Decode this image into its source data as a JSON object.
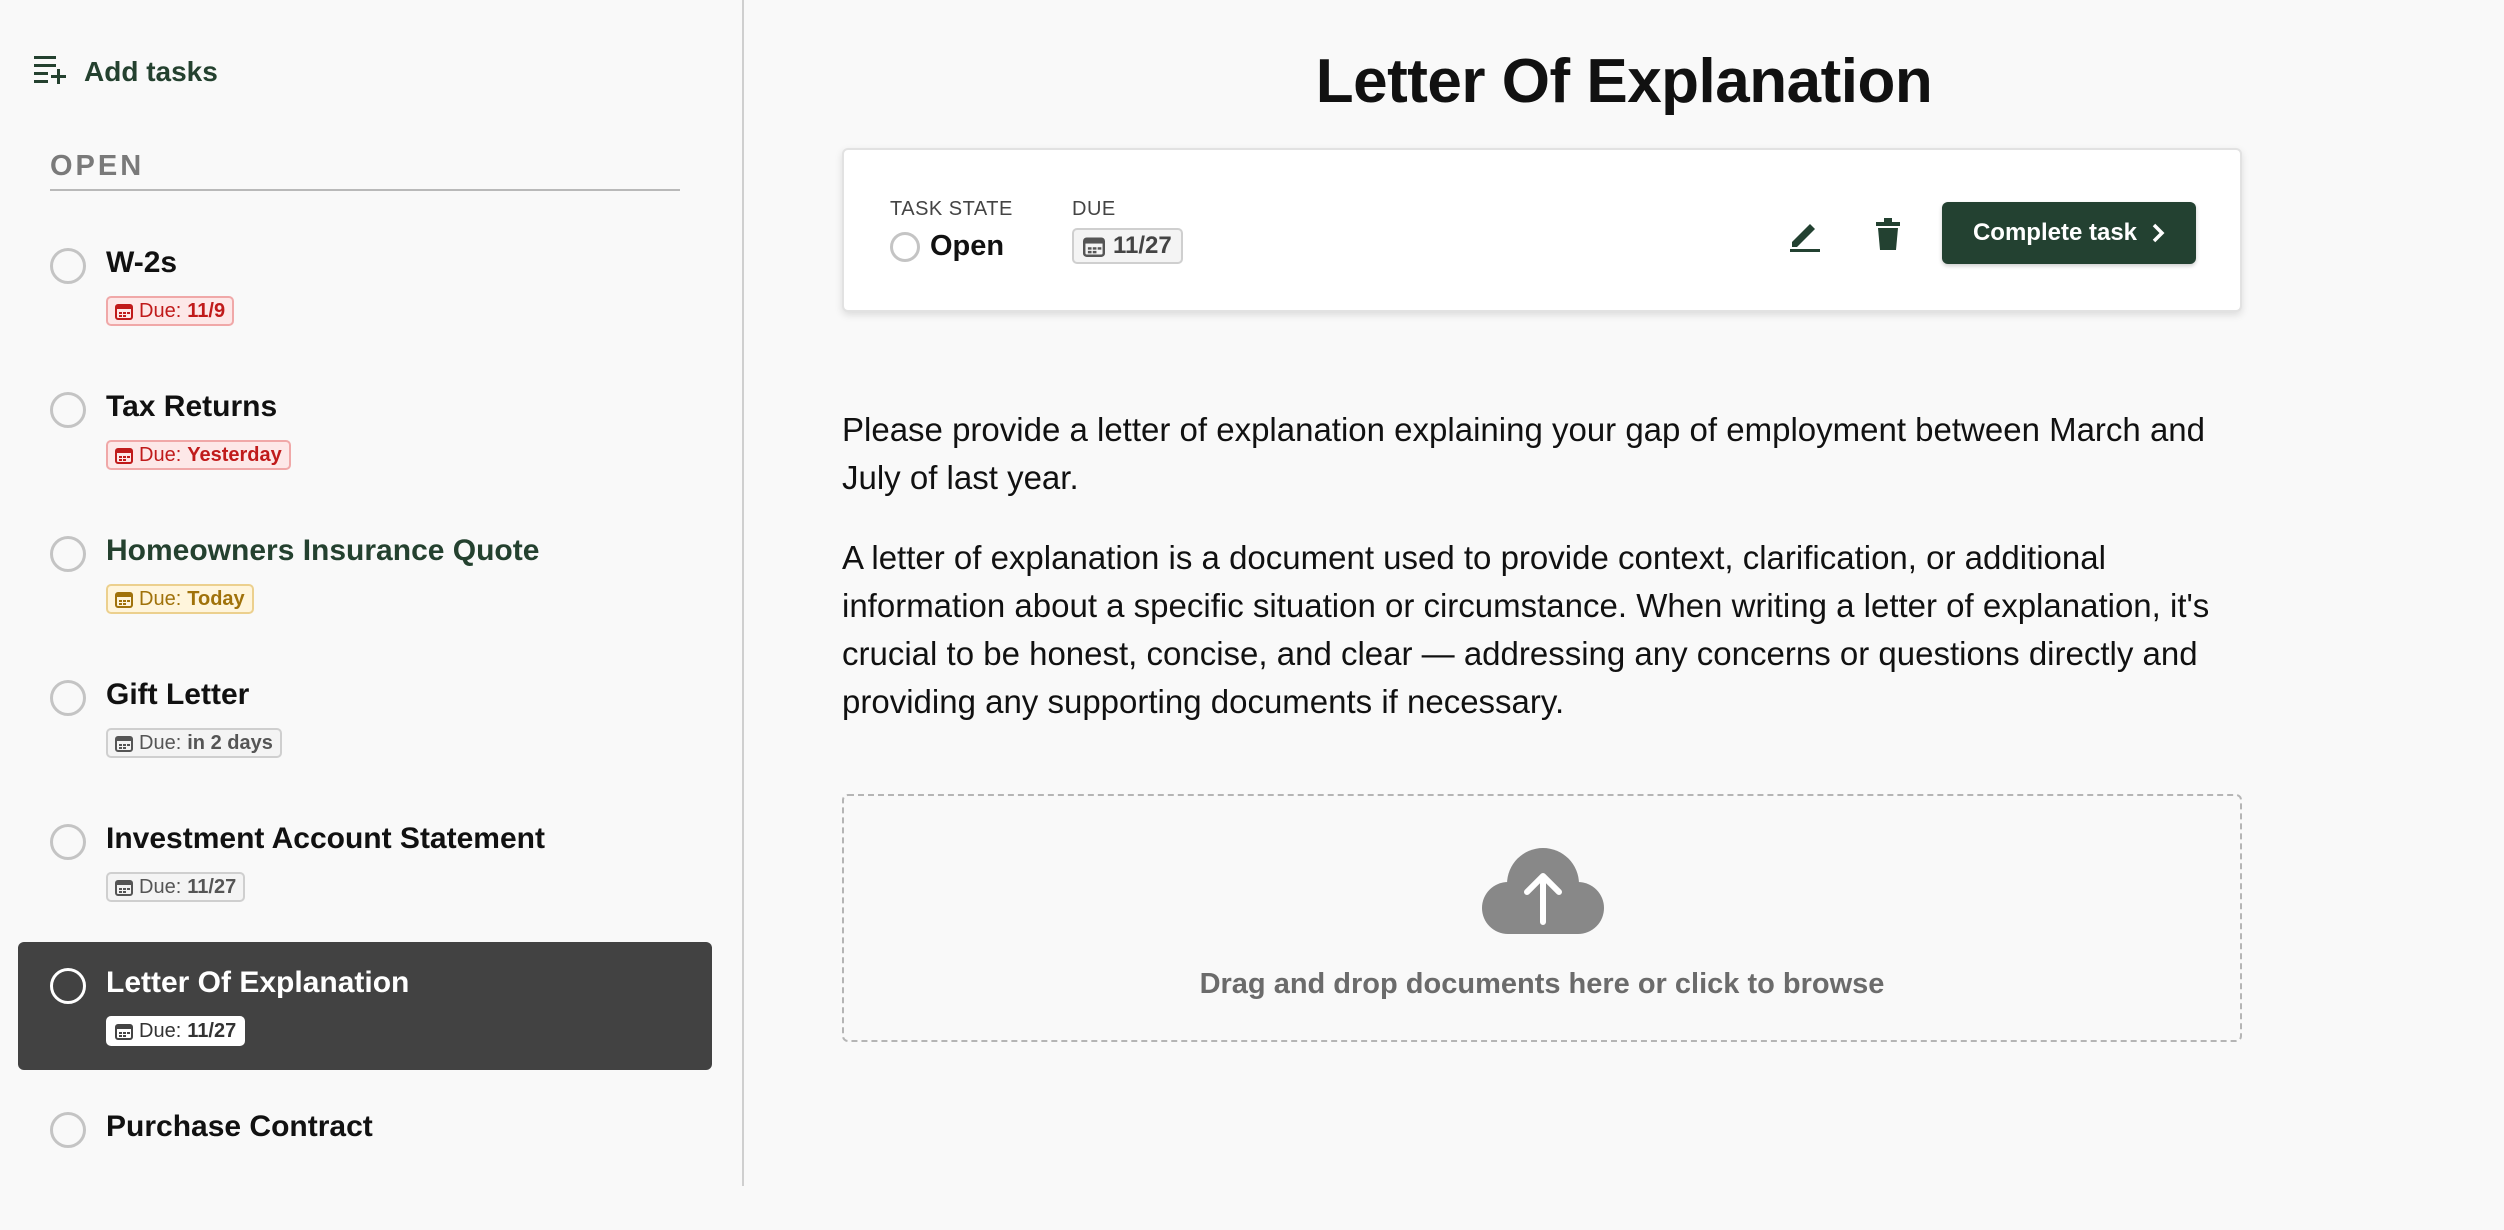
{
  "sidebar": {
    "add_tasks_label": "Add tasks",
    "section_header": "OPEN",
    "tasks": [
      {
        "title": "W-2s",
        "due_prefix": "Due:",
        "due_value": "11/9",
        "status": "overdue"
      },
      {
        "title": "Tax Returns",
        "due_prefix": "Due:",
        "due_value": "Yesterday",
        "status": "overdue"
      },
      {
        "title": "Homeowners Insurance Quote",
        "due_prefix": "Due:",
        "due_value": "Today",
        "status": "today"
      },
      {
        "title": "Gift Letter",
        "due_prefix": "Due:",
        "due_value": "in 2 days",
        "status": "upcoming"
      },
      {
        "title": "Investment Account Statement",
        "due_prefix": "Due:",
        "due_value": "11/27",
        "status": "upcoming"
      },
      {
        "title": "Letter Of Explanation",
        "due_prefix": "Due:",
        "due_value": "11/27",
        "status": "selected"
      },
      {
        "title": "Purchase Contract",
        "due_prefix": "",
        "due_value": "",
        "status": "upcoming"
      }
    ]
  },
  "main": {
    "title": "Letter Of Explanation",
    "card": {
      "task_state_label": "TASK STATE",
      "task_state_value": "Open",
      "due_label": "DUE",
      "due_value": "11/27",
      "complete_label": "Complete task"
    },
    "description": [
      "Please provide a letter of explanation explaining your gap of employment between March and July of last year.",
      "A letter of explanation is a document used to provide context, clarification, or additional information about a specific situation or circumstance. When writing a letter of explanation, it's crucial to be honest, concise, and clear — addressing any concerns or questions directly and providing any supporting documents if necessary."
    ],
    "dropzone_text": "Drag and drop documents here or click to browse"
  },
  "colors": {
    "brand_green": "#234131",
    "selected_bg": "#424242",
    "overdue_red": "#c01b1b",
    "today_amber": "#a0720b"
  }
}
